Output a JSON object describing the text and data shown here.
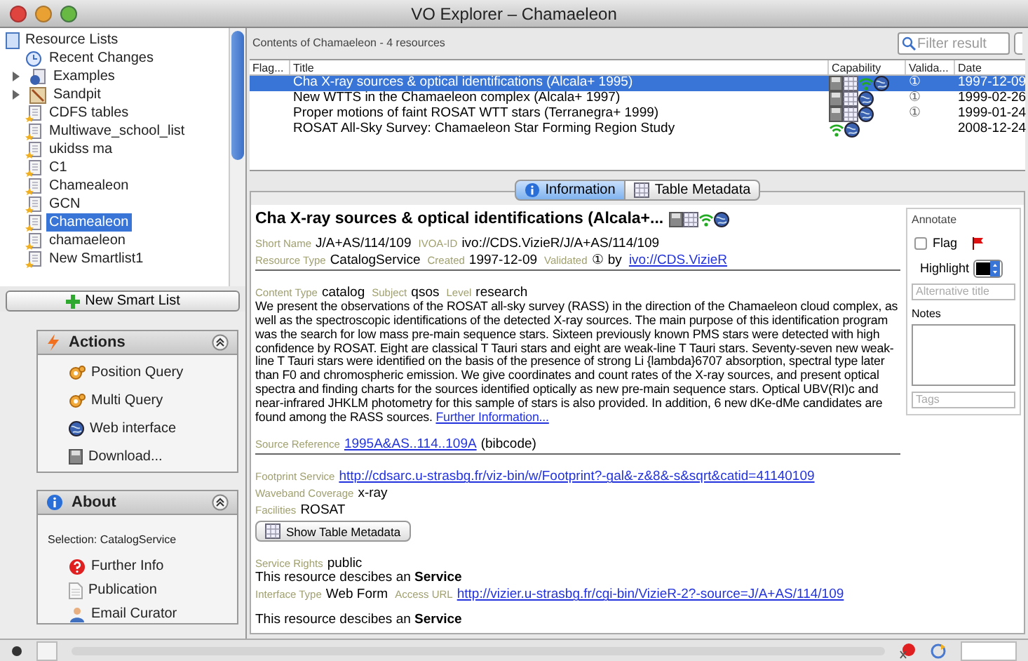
{
  "window": {
    "title": "VO Explorer – Chamaeleon"
  },
  "sidebar": {
    "root": {
      "label": "Resource Lists",
      "children": [
        {
          "label": "Recent Changes",
          "kind": "recent",
          "selected": false
        },
        {
          "label": "Examples",
          "kind": "folder",
          "expanded": false,
          "selected": false
        },
        {
          "label": "Sandpit",
          "kind": "sandpit",
          "expanded": false,
          "selected": false
        },
        {
          "label": "CDFS tables",
          "kind": "list",
          "selected": false
        },
        {
          "label": "Multiwave_school_list",
          "kind": "list",
          "selected": false
        },
        {
          "label": "ukidss ma",
          "kind": "list",
          "selected": false
        },
        {
          "label": "C1",
          "kind": "list",
          "selected": false
        },
        {
          "label": "Chamealeon",
          "kind": "list",
          "selected": false
        },
        {
          "label": "GCN",
          "kind": "list",
          "selected": false
        },
        {
          "label": "Chamealeon",
          "kind": "list",
          "selected": true
        },
        {
          "label": "chamaeleon",
          "kind": "list",
          "selected": false
        },
        {
          "label": "New Smartlist1",
          "kind": "list",
          "selected": false
        }
      ]
    },
    "new_button": "New Smart List"
  },
  "actions": {
    "title": "Actions",
    "items": [
      {
        "label": "Position Query",
        "kind": "query"
      },
      {
        "label": "Multi Query",
        "kind": "query"
      },
      {
        "label": "Web interface",
        "kind": "web"
      },
      {
        "label": "Download...",
        "kind": "download"
      }
    ]
  },
  "about": {
    "title": "About",
    "selection": "Selection: CatalogService",
    "items": [
      {
        "label": "Further Info",
        "kind": "help"
      },
      {
        "label": "Publication",
        "kind": "doc"
      },
      {
        "label": "Email Curator",
        "kind": "person"
      }
    ]
  },
  "contents": {
    "heading": "Contents of Chamaeleon - 4 resources",
    "filter_placeholder": "Filter result",
    "columns": [
      "Flag...",
      "Title",
      "Capability",
      "Valida...",
      "Date"
    ],
    "rows": [
      {
        "title": "Cha X-ray sources & optical identifications (Alcala+ 1995)",
        "capabilities": [
          {
            "kind": "download"
          },
          {
            "kind": "table"
          },
          {
            "kind": "cone"
          },
          {
            "kind": "web"
          }
        ],
        "validated": "①",
        "date": "1997-12-09",
        "selected": true
      },
      {
        "title": "New WTTS in the Chamaeleon complex (Alcala+ 1997)",
        "capabilities": [
          {
            "kind": "download"
          },
          {
            "kind": "table"
          },
          {
            "kind": "web"
          }
        ],
        "validated": "①",
        "date": "1999-02-26",
        "selected": false
      },
      {
        "title": "Proper motions of faint ROSAT WTT stars (Terranegra+ 1999)",
        "capabilities": [
          {
            "kind": "download"
          },
          {
            "kind": "table"
          },
          {
            "kind": "web"
          }
        ],
        "validated": "①",
        "date": "1999-01-24",
        "selected": false
      },
      {
        "title": "ROSAT All-Sky Survey: Chamaeleon Star Forming Region Study",
        "capabilities": [
          {
            "kind": "cone"
          },
          {
            "kind": "web"
          }
        ],
        "date": "2008-12-24",
        "selected": false
      }
    ]
  },
  "tabs": [
    {
      "label": "Information",
      "kind": "info",
      "selected": true
    },
    {
      "label": "Table Metadata",
      "kind": "table",
      "selected": false
    }
  ],
  "details": {
    "title": "Cha X-ray sources & optical identifications (Alcala+...",
    "capabilities": [
      {
        "kind": "download"
      },
      {
        "kind": "table"
      },
      {
        "kind": "cone"
      },
      {
        "kind": "web"
      }
    ],
    "blocks": [
      {
        "kind": "fields",
        "items": [
          {
            "label": "Short Name",
            "value": "J/A+AS/114/109"
          },
          {
            "label": "IVOA-ID",
            "value": "ivo://CDS.VizieR/J/A+AS/114/109"
          }
        ]
      },
      {
        "kind": "fields",
        "items": [
          {
            "label": "Resource Type",
            "value": "CatalogService"
          },
          {
            "label": "Created",
            "value": "1997-12-09"
          },
          {
            "label": "Validated",
            "value": "① by",
            "link": "ivo://CDS.VizieR"
          }
        ]
      },
      {
        "kind": "rule"
      },
      {
        "kind": "fields",
        "items": [
          {
            "label": "Content Type",
            "value": "catalog"
          },
          {
            "label": "Subject",
            "value": "qsos"
          },
          {
            "label": "Level",
            "value": "research"
          }
        ]
      },
      {
        "kind": "paragraph",
        "text": "We present the observations of the ROSAT all-sky survey (RASS) in the direction of the Chamaeleon cloud complex, as well as the spectroscopic identifications of the detected X-ray sources. The main purpose of this identification program was the search for low mass pre-main sequence stars. Sixteen previously known PMS stars were detected with high confidence by ROSAT. Eight are classical T Tauri stars and eight are weak-line T Tauri stars. Seventy-seven new weak-line T Tauri stars were identified on the basis of the presence of strong Li {lambda}6707 absorption, spectral type later than F0 and chromospheric emission. We give coordinates and count rates of the X-ray sources, and present optical spectra and finding charts for the sources identified optically as new pre-main sequence stars. Optical UBV(RI)c and near-infrared JHKLM photometry for this sample of stars is also provided. In addition, 6 new dKe-dMe candidates are found among the RASS sources.",
        "link": "Further Information..."
      },
      {
        "kind": "blank"
      },
      {
        "kind": "fields",
        "items": [
          {
            "label": "Source Reference",
            "link": "1995A&AS..114..109A",
            "value": "(bibcode)"
          }
        ]
      },
      {
        "kind": "rule"
      },
      {
        "kind": "fields",
        "items": [
          {
            "label": "Footprint Service",
            "link": "http://cdsarc.u-strasbg.fr/viz-bin/w/Footprint?-gal&-z&8&-s&sqrt&catid=41140109"
          }
        ]
      },
      {
        "kind": "fields",
        "items": [
          {
            "label": "Waveband Coverage",
            "value": "x-ray"
          }
        ]
      },
      {
        "kind": "fields",
        "items": [
          {
            "label": "Facilities",
            "value": "ROSAT"
          }
        ]
      },
      {
        "kind": "button",
        "label": "Show Table Metadata"
      },
      {
        "kind": "blank"
      },
      {
        "kind": "fields",
        "items": [
          {
            "label": "Service Rights",
            "value": "public"
          }
        ]
      },
      {
        "kind": "sentence",
        "text": "This resource descibes an **Service**"
      },
      {
        "kind": "fields",
        "items": [
          {
            "label": "Interface Type",
            "value": "Web Form"
          },
          {
            "label": "Access URL",
            "link": "http://vizier.u-strasbg.fr/cgi-bin/VizieR-2?-source=J/A+AS/114/109"
          }
        ]
      },
      {
        "kind": "blank"
      },
      {
        "kind": "sentence",
        "text": "This resource descibes an **Service**"
      }
    ]
  },
  "annotate": {
    "title": "Annotate",
    "flag_label": "Flag",
    "flagged": false,
    "highlight": {
      "label": "Highlight",
      "color": "#000000"
    },
    "alt_title_placeholder": "Alternative title",
    "notes_label": "Notes",
    "tags_placeholder": "Tags"
  }
}
